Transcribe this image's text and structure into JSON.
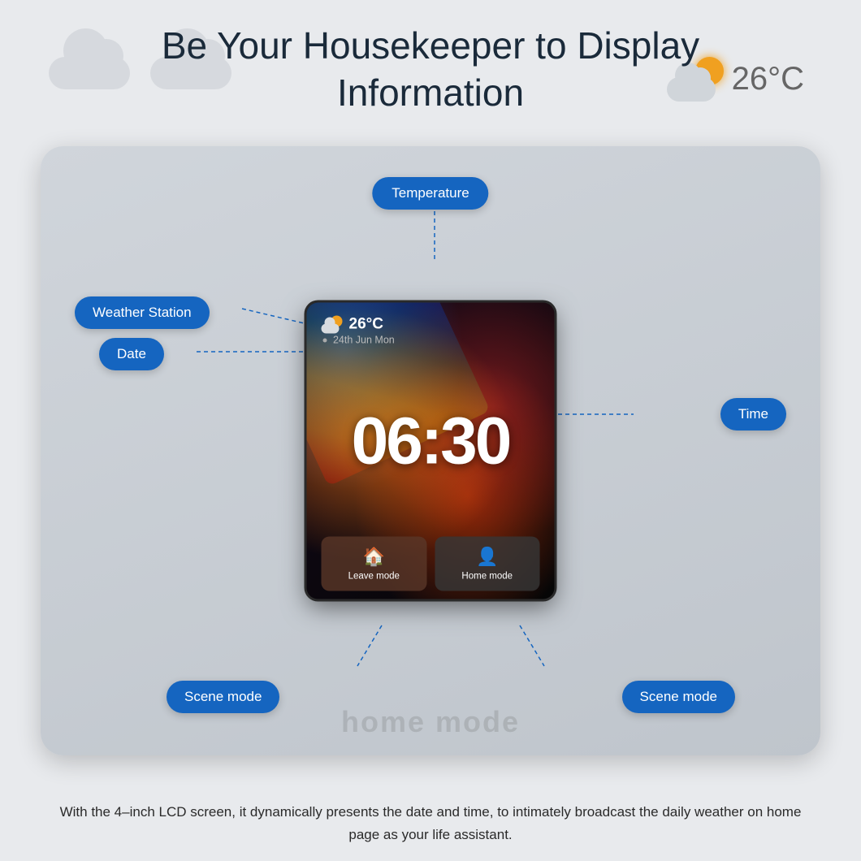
{
  "page": {
    "title_line1": "Be Your Housekeeper to Display",
    "title_line2": "Information",
    "bg_temp": "26°C"
  },
  "screen": {
    "weather_temp": "26°C",
    "date": "24th Jun  Mon",
    "time": "06:30",
    "leave_mode_label": "Leave mode",
    "home_mode_label": "Home mode"
  },
  "labels": {
    "temperature": "Temperature",
    "weather_station": "Weather Station",
    "date": "Date",
    "time": "Time",
    "scene_mode_left": "Scene mode",
    "scene_mode_right": "Scene mode"
  },
  "footer": {
    "text": "With the 4–inch LCD screen, it dynamically presents the date and time, to\nintimately broadcast the daily weather on home page as your life assistant."
  },
  "colors": {
    "label_bg": "#1565c0",
    "label_text": "#ffffff"
  }
}
